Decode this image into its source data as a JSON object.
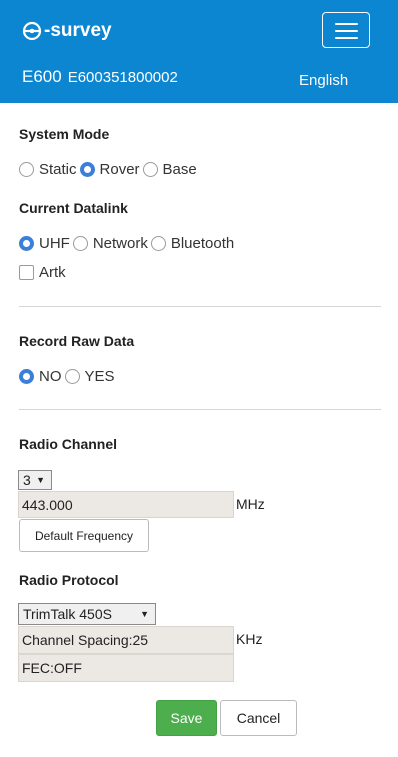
{
  "header": {
    "brand": "-survey",
    "device_model": "E600",
    "device_serial": "E600351800002",
    "language": "English",
    "bg_color": "#0d86d1"
  },
  "system_mode": {
    "title": "System Mode",
    "options": [
      "Static",
      "Rover",
      "Base"
    ],
    "selected": "Rover"
  },
  "datalink": {
    "title": "Current Datalink",
    "options": [
      "UHF",
      "Network",
      "Bluetooth"
    ],
    "selected": "UHF",
    "artk_label": "Artk",
    "artk_checked": false
  },
  "raw_data": {
    "title": "Record Raw Data",
    "options": [
      "NO",
      "YES"
    ],
    "selected": "NO"
  },
  "radio_channel": {
    "title": "Radio Channel",
    "channel": "3",
    "frequency": "443.000",
    "frequency_unit": "MHz",
    "default_button": "Default Frequency"
  },
  "radio_protocol": {
    "title": "Radio Protocol",
    "protocol": "TrimTalk 450S",
    "channel_spacing": "Channel Spacing:25",
    "spacing_unit": "KHz",
    "fec": "FEC:OFF"
  },
  "actions": {
    "save": "Save",
    "cancel": "Cancel",
    "save_color": "#4cae4c"
  },
  "accent_color": "#3b7fd8"
}
